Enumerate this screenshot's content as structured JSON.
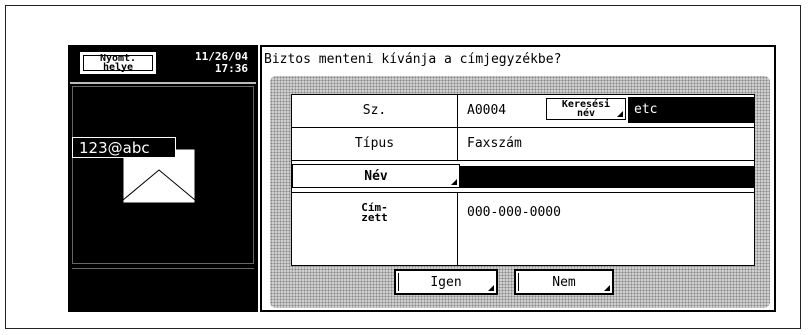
{
  "header": {
    "place_button": "Nyomt.\nhelye",
    "date": "11/26/04",
    "time": "17:36"
  },
  "left_panel": {
    "address": "123@abc"
  },
  "dialog": {
    "question": "Biztos menteni kívánja a címjegyzékbe?",
    "rows": [
      {
        "label": "Sz.",
        "value": "A0004"
      },
      {
        "label": "Típus",
        "value": "Faxszám"
      },
      {
        "label": "Név",
        "value": ""
      },
      {
        "label": "Cím-\nzett",
        "value": "000-000-0000"
      }
    ],
    "search_button": "Keresési\nnév",
    "search_value": "etc",
    "buttons": {
      "yes": "Igen",
      "no": "Nem"
    }
  },
  "colors": {
    "background": "#ffffff",
    "panel": "#000000",
    "dialog_inner": "#cfcfcf"
  }
}
